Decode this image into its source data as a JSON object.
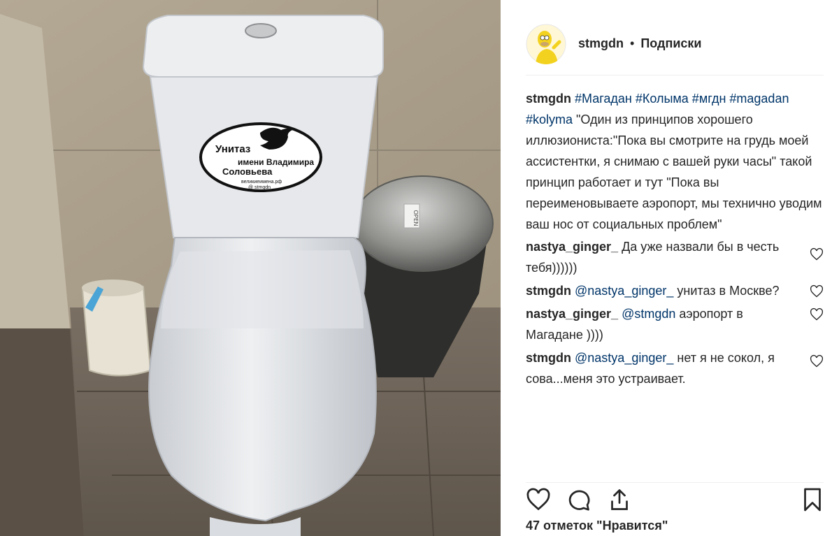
{
  "photo": {
    "sticker_title": "Унитаз",
    "sticker_line2": "имени Владимира",
    "sticker_line3": "Соловьева",
    "sticker_site": "великиеимена.рф",
    "sticker_handle": "@ stmgdn",
    "bin_label": "OPEN"
  },
  "header": {
    "username": "stmgdn",
    "separator": "•",
    "follow_label": "Подписки"
  },
  "caption": {
    "username": "stmgdn",
    "tags": "#Магадан #Колыма #мгдн #magadan #kolyma",
    "text": "\"Один из принципов хорошего иллюзиониста:\"Пока вы смотрите на грудь моей ассистентки, я снимаю с вашей руки часы\" такой принцип работает и тут \"Пока вы переименовываете аэропорт, мы технично уводим ваш нос от социальных проблем\""
  },
  "comments": [
    {
      "username": "nastya_ginger_",
      "mention": "",
      "text": "Да уже назвали бы в честь тебя))))))"
    },
    {
      "username": "stmgdn",
      "mention": "@nastya_ginger_",
      "text": "унитаз в Москве?"
    },
    {
      "username": "nastya_ginger_",
      "mention": "@stmgdn",
      "text": "аэропорт в Магадане ))))"
    },
    {
      "username": "stmgdn",
      "mention": "@nastya_ginger_",
      "text": "нет я не сокол, я сова...меня это устраивает."
    }
  ],
  "icons": {
    "like": "heart-icon",
    "comment": "comment-icon",
    "share": "share-icon",
    "save": "bookmark-icon"
  },
  "likes_text": "47 отметок \"Нравится\"",
  "colors": {
    "link": "#003569",
    "text": "#262626",
    "border": "#efefef"
  }
}
